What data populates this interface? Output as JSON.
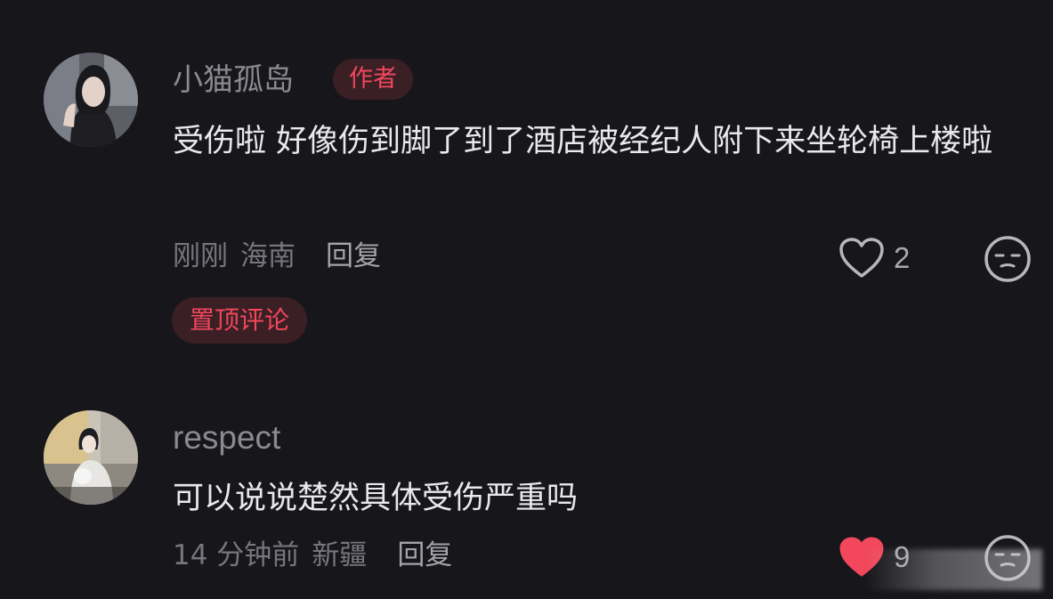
{
  "comments": [
    {
      "username": "小猫孤岛",
      "badge": "作者",
      "content": "受伤啦 好像伤到脚了到了酒店被经纪人附下来坐轮椅上楼啦",
      "time": "刚刚",
      "location": "海南",
      "reply_label": "回复",
      "likes": "2",
      "pinned_label": "置顶评论"
    },
    {
      "username": "respect",
      "content": "可以说说楚然具体受伤严重吗",
      "time": "14 分钟前",
      "location": "新疆",
      "reply_label": "回复",
      "likes": "9"
    }
  ],
  "colors": {
    "background": "#17161b",
    "accent": "#f2475c",
    "like_active": "#f2475c"
  },
  "icons": [
    "heart-icon",
    "emoji-icon",
    "heart-filled-icon"
  ]
}
